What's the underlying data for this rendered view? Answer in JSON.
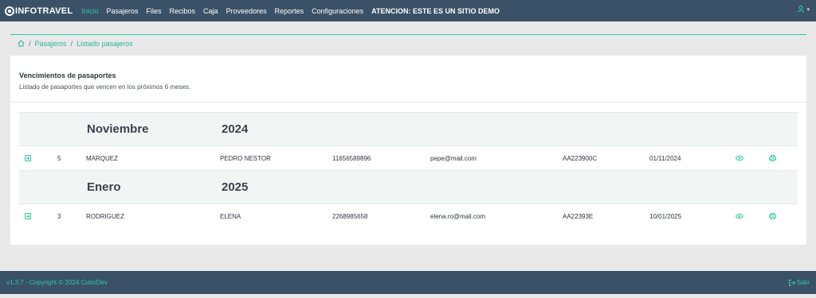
{
  "nav": {
    "brand": "INFOTRAVEL",
    "items": [
      {
        "label": "Inicio",
        "active": true
      },
      {
        "label": "Pasajeros",
        "active": false
      },
      {
        "label": "Files",
        "active": false
      },
      {
        "label": "Recibos",
        "active": false
      },
      {
        "label": "Caja",
        "active": false
      },
      {
        "label": "Proveedores",
        "active": false
      },
      {
        "label": "Reportes",
        "active": false
      },
      {
        "label": "Configuraciones",
        "active": false
      }
    ],
    "warning": "ATENCION: ESTE ES UN SITIO DEMO"
  },
  "breadcrumb": {
    "items": [
      "Pasajeros",
      "Listado pasajeros"
    ]
  },
  "card": {
    "title": "Vencimientos de pasaportes",
    "subtitle": "Listado de pasaportes que vencen en los próximos 6 meses."
  },
  "groups": [
    {
      "month": "Noviembre",
      "year": "2024",
      "rows": [
        {
          "num": "5",
          "last": "MARQUEZ",
          "first": "PEDRO NESTOR",
          "phone": "11656589896",
          "email": "pepe@mail.com",
          "passport": "AA223900C",
          "date": "01/11/2024"
        }
      ]
    },
    {
      "month": "Enero",
      "year": "2025",
      "rows": [
        {
          "num": "3",
          "last": "RODRIGUEZ",
          "first": "ELENA",
          "phone": "2268985658",
          "email": "elena.ro@mail.com",
          "passport": "AA22393E",
          "date": "10/01/2025"
        }
      ]
    }
  ],
  "footer": {
    "copyright": "v1.3.7 - Copyright © 2024 CuboDev",
    "logout": "Salir"
  },
  "colors": {
    "nav_bg": "#3b5167",
    "accent": "#2ec8a5"
  },
  "icons": {
    "home": "home-icon",
    "expand": "plus-square-icon",
    "view": "eye-icon",
    "print": "printer-icon",
    "user": "user-icon",
    "logout": "logout-icon"
  }
}
